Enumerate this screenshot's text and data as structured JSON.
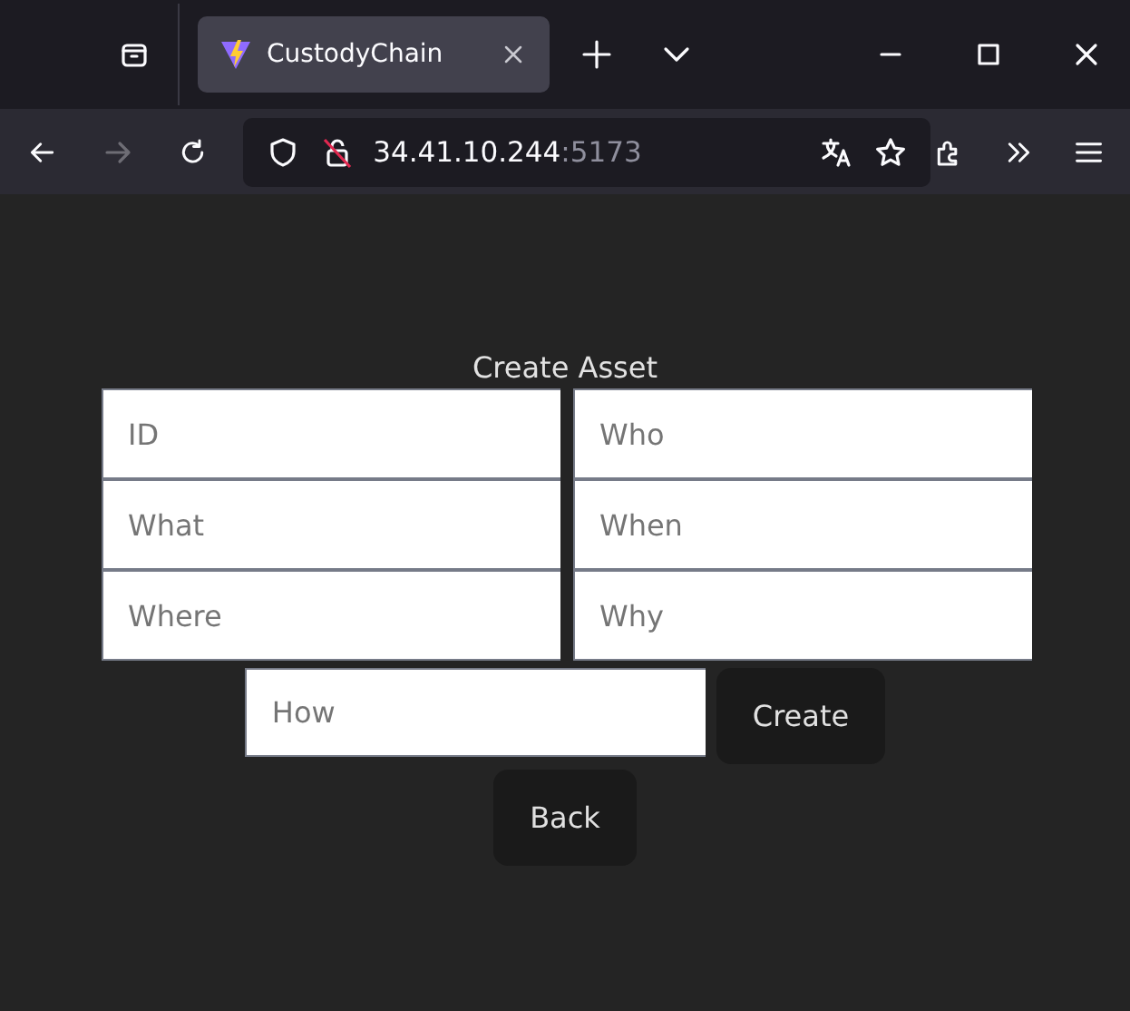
{
  "browser": {
    "tab": {
      "title": "CustodyChain",
      "selected": true
    },
    "forward_disabled": true,
    "url": {
      "host": "34.41.10.244",
      "port": ":5173"
    }
  },
  "form": {
    "title": "Create Asset",
    "fields": [
      {
        "placeholder": "ID"
      },
      {
        "placeholder": "Who"
      },
      {
        "placeholder": "What"
      },
      {
        "placeholder": "When"
      },
      {
        "placeholder": "Where"
      },
      {
        "placeholder": "Why"
      }
    ],
    "how": {
      "placeholder": "How"
    },
    "create_button": "Create",
    "back_button": "Back"
  }
}
